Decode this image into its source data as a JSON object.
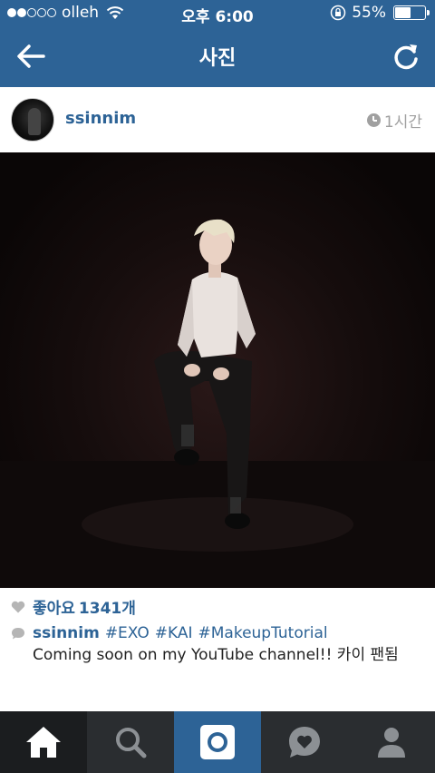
{
  "status_bar": {
    "carrier": "olleh",
    "time": "오후 6:00",
    "battery_percent": "55%",
    "battery_level": 0.55,
    "signal_bars": 2
  },
  "nav": {
    "title": "사진",
    "back_icon": "arrow-left-icon",
    "refresh_icon": "refresh-icon"
  },
  "post": {
    "username": "ssinnim",
    "time": "1시간",
    "likes_label": "좋아요",
    "likes_count": "1341개",
    "caption": {
      "user": "ssinnim",
      "hashtags": [
        "#EXO",
        "#KAI",
        "#MakeupTutorial"
      ],
      "text": "Coming soon on my YouTube channel!! 카이 팬됨"
    }
  },
  "tabs": [
    {
      "name": "home",
      "icon": "home-icon"
    },
    {
      "name": "search",
      "icon": "search-icon"
    },
    {
      "name": "camera",
      "icon": "camera-icon"
    },
    {
      "name": "activity",
      "icon": "heart-bubble-icon"
    },
    {
      "name": "profile",
      "icon": "person-icon"
    }
  ],
  "colors": {
    "header": "#2d6396",
    "tabbar": "#2a2d30",
    "link": "#2d6396"
  }
}
